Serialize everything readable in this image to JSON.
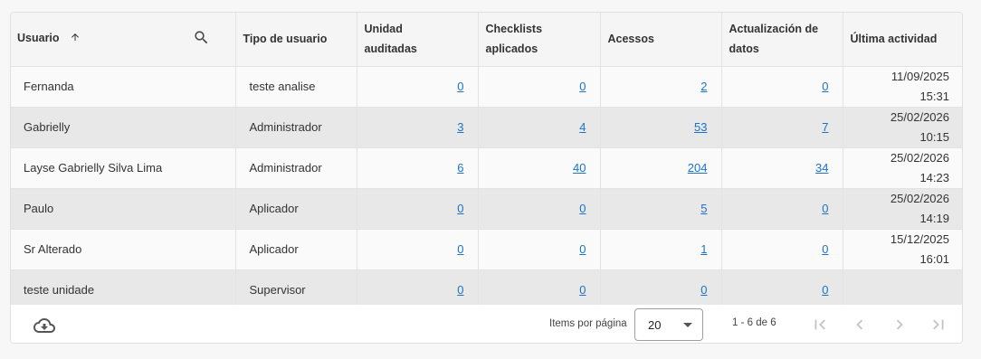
{
  "table": {
    "columns": [
      "Usuario",
      "Tipo de usuario",
      "Unidad auditadas",
      "Checklists aplicados",
      "Acessos",
      "Actualización de datos",
      "Última actividad"
    ],
    "rows": [
      {
        "usuario": "Fernanda",
        "tipo": "teste analise",
        "unidad": "0",
        "checklists": "0",
        "acessos": "2",
        "actualizacion": "0",
        "fecha": "11/09/2025",
        "hora": "15:31"
      },
      {
        "usuario": "Gabrielly",
        "tipo": "Administrador",
        "unidad": "3",
        "checklists": "4",
        "acessos": "53",
        "actualizacion": "7",
        "fecha": "25/02/2026",
        "hora": "10:15"
      },
      {
        "usuario": "Layse Gabrielly Silva Lima",
        "tipo": "Administrador",
        "unidad": "6",
        "checklists": "40",
        "acessos": "204",
        "actualizacion": "34",
        "fecha": "25/02/2026",
        "hora": "14:23"
      },
      {
        "usuario": "Paulo",
        "tipo": "Aplicador",
        "unidad": "0",
        "checklists": "0",
        "acessos": "5",
        "actualizacion": "0",
        "fecha": "25/02/2026",
        "hora": "14:19"
      },
      {
        "usuario": "Sr Alterado",
        "tipo": "Aplicador",
        "unidad": "0",
        "checklists": "0",
        "acessos": "1",
        "actualizacion": "0",
        "fecha": "15/12/2025",
        "hora": "16:01"
      },
      {
        "usuario": "teste unidade",
        "tipo": "Supervisor",
        "unidad": "0",
        "checklists": "0",
        "acessos": "0",
        "actualizacion": "0",
        "fecha": "",
        "hora": ""
      }
    ]
  },
  "footer": {
    "items_per_page_label": "Items por página",
    "items_per_page_value": "20",
    "range_label": "1 - 6 de 6"
  },
  "icons": {
    "sort": "arrow-up-icon",
    "search": "search-icon",
    "download": "cloud-download-icon",
    "first": "first-page-icon",
    "prev": "chevron-left-icon",
    "next": "chevron-right-icon",
    "last": "last-page-icon"
  },
  "colors": {
    "link": "#1a73c8",
    "header_bg": "#f5f5f5",
    "row_alt": "#e8e8e8"
  }
}
